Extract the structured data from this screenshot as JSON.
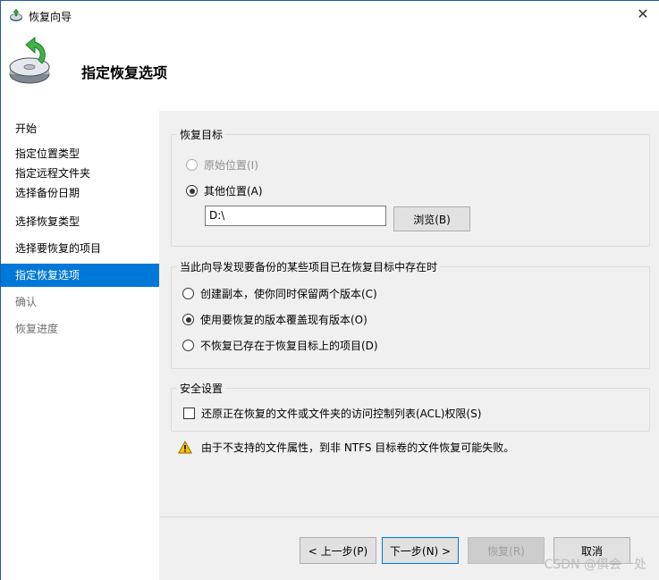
{
  "window": {
    "title": "恢复向导",
    "close_glyph": "✕"
  },
  "header": {
    "title": "指定恢复选项",
    "icon": "restore-wizard-icon"
  },
  "nav": {
    "items": [
      {
        "label": "开始",
        "state": "normal"
      },
      {
        "label": "指定位置类型",
        "state": "normal"
      },
      {
        "label": "指定远程文件夹",
        "state": "normal"
      },
      {
        "label": "选择备份日期",
        "state": "normal"
      },
      {
        "label": "选择恢复类型",
        "state": "normal"
      },
      {
        "label": "选择要恢复的项目",
        "state": "normal"
      },
      {
        "label": "指定恢复选项",
        "state": "selected"
      },
      {
        "label": "确认",
        "state": "disabled"
      },
      {
        "label": "恢复进度",
        "state": "disabled"
      }
    ]
  },
  "restore_target": {
    "legend": "恢复目标",
    "original_label": "原始位置(I)",
    "other_label": "其他位置(A)",
    "path_value": "D:\\",
    "browse_label": "浏览(B)"
  },
  "conflict": {
    "legend": "当此向导发现要备份的某些项目已在恢复目标中存在时",
    "options": [
      {
        "label": "创建副本，使你同时保留两个版本(C)",
        "checked": false
      },
      {
        "label": "使用要恢复的版本覆盖现有版本(O)",
        "checked": true
      },
      {
        "label": "不恢复已存在于恢复目标上的项目(D)",
        "checked": false
      }
    ]
  },
  "security": {
    "legend": "安全设置",
    "acl_label": "还原正在恢复的文件或文件夹的访问控制列表(ACL)权限(S)"
  },
  "warning": {
    "icon": "warning-icon",
    "text": "由于不支持的文件属性，到非 NTFS 目标卷的文件恢复可能失败。"
  },
  "buttons": {
    "back": "< 上一步(P)",
    "next": "下一步(N) >",
    "restore": "恢复(R)",
    "cancel": "取消"
  },
  "watermark": "CSDN @俱会一处",
  "colors": {
    "accent": "#0078d7",
    "content_bg": "#f0f0f0",
    "warning": "#f5c400"
  }
}
